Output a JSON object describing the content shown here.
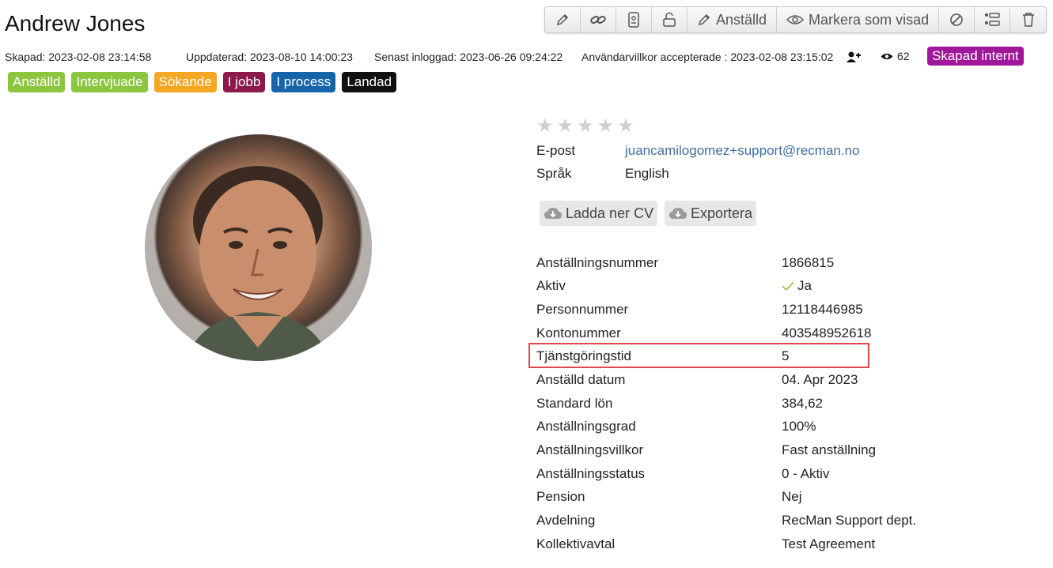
{
  "candidate": {
    "name": "Andrew Jones"
  },
  "toolbar": {
    "buttons": [
      {
        "icon": "pencil-icon",
        "label": ""
      },
      {
        "icon": "link-icon",
        "label": ""
      },
      {
        "icon": "id-card-icon",
        "label": ""
      },
      {
        "icon": "unlock-icon",
        "label": ""
      },
      {
        "icon": "pencil-icon",
        "label": "Anställd"
      },
      {
        "icon": "eye-icon",
        "label": "Markera som visad"
      },
      {
        "icon": "ban-icon",
        "label": ""
      },
      {
        "icon": "list-icon",
        "label": ""
      },
      {
        "icon": "trash-icon",
        "label": ""
      }
    ]
  },
  "meta": {
    "created": "Skapad: 2023-02-08 23:14:58",
    "updated": "Uppdaterad: 2023-08-10 14:00:23",
    "last_login": "Senast inloggad: 2023-06-26 09:24:22",
    "terms": "Användarvillkor accepterade : 2023-02-08 23:15:02",
    "views": "62",
    "internal_badge": "Skapad internt",
    "internal_badge_color": "#a0179b"
  },
  "tags": [
    {
      "label": "Anställd",
      "color": "#8cc63f"
    },
    {
      "label": "Intervjuade",
      "color": "#8cc63f"
    },
    {
      "label": "Sökande",
      "color": "#f5a623"
    },
    {
      "label": "I jobb",
      "color": "#8b1a4a"
    },
    {
      "label": "I process",
      "color": "#1565a8"
    },
    {
      "label": "Landad",
      "color": "#111111"
    }
  ],
  "rating": {
    "value": 0,
    "max": 5
  },
  "contact": {
    "email_label": "E-post",
    "email_value": "juancamilogomez+support@recman.no",
    "language_label": "Språk",
    "language_value": "English"
  },
  "actions": {
    "download_cv": "Ladda ner CV",
    "export": "Exportera"
  },
  "details": [
    {
      "label": "Anställningsnummer",
      "value": "1866815"
    },
    {
      "label": "Aktiv",
      "value": "Ja",
      "check": true
    },
    {
      "label": "Personnummer",
      "value": "12118446985"
    },
    {
      "label": "Kontonummer",
      "value": "403548952618"
    },
    {
      "label": "Tjänstgöringstid",
      "value": "5"
    },
    {
      "label": "Anställd datum",
      "value": "04. Apr 2023"
    },
    {
      "label": "Standard lön",
      "value": "384,62"
    },
    {
      "label": "Anställningsgrad",
      "value": "100%"
    },
    {
      "label": "Anställningsvillkor",
      "value": "Fast anställning"
    },
    {
      "label": "Anställningsstatus",
      "value": "0 - Aktiv"
    },
    {
      "label": "Pension",
      "value": "Nej"
    },
    {
      "label": "Avdelning",
      "value": "RecMan Support dept."
    },
    {
      "label": "Kollektivavtal",
      "value": "Test Agreement"
    }
  ]
}
